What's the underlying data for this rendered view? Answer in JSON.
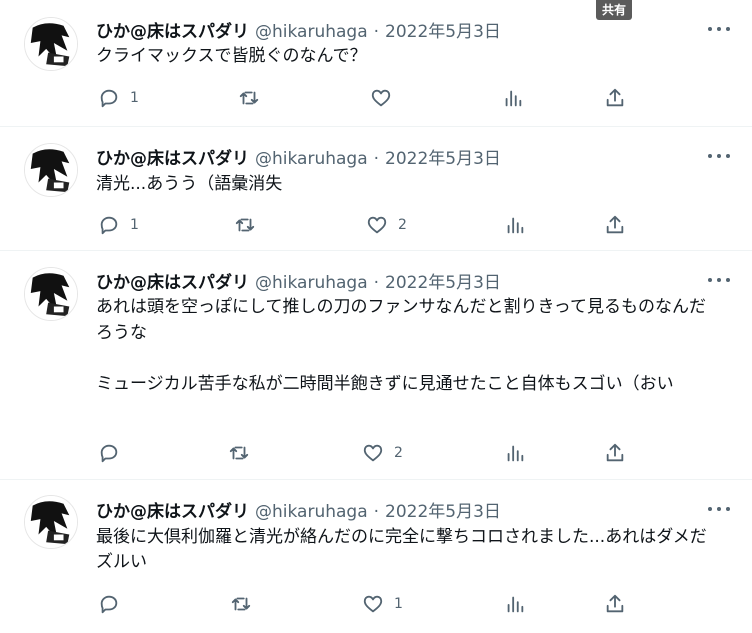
{
  "share_badge": "共有",
  "tweets": [
    {
      "name": "ひか@床はスパダリ",
      "handle": "@hikaruhaga",
      "sep": "·",
      "date": "2022年5月3日",
      "text": "クライマックスで皆脱ぐのなんで？",
      "replies": "1",
      "retweets": "",
      "likes": "",
      "views": ""
    },
    {
      "name": "ひか@床はスパダリ",
      "handle": "@hikaruhaga",
      "sep": "·",
      "date": "2022年5月3日",
      "text": "清光...あうう（語彙消失",
      "replies": "1",
      "retweets": "",
      "likes": "2",
      "views": ""
    },
    {
      "name": "ひか@床はスパダリ",
      "handle": "@hikaruhaga",
      "sep": "·",
      "date": "2022年5月3日",
      "text": "あれは頭を空っぽにして推しの刀のファンサなんだと割りきって見るものなんだろうな\n\nミュージカル苦手な私が二時間半飽きずに見通せたこと自体もスゴい（おい",
      "replies": "",
      "retweets": "",
      "likes": "2",
      "views": ""
    },
    {
      "name": "ひか@床はスパダリ",
      "handle": "@hikaruhaga",
      "sep": "·",
      "date": "2022年5月3日",
      "text": "最後に大倶利伽羅と清光が絡んだのに完全に撃ちコロされました...あれはダメだズルい",
      "replies": "",
      "retweets": "",
      "likes": "1",
      "views": ""
    }
  ]
}
